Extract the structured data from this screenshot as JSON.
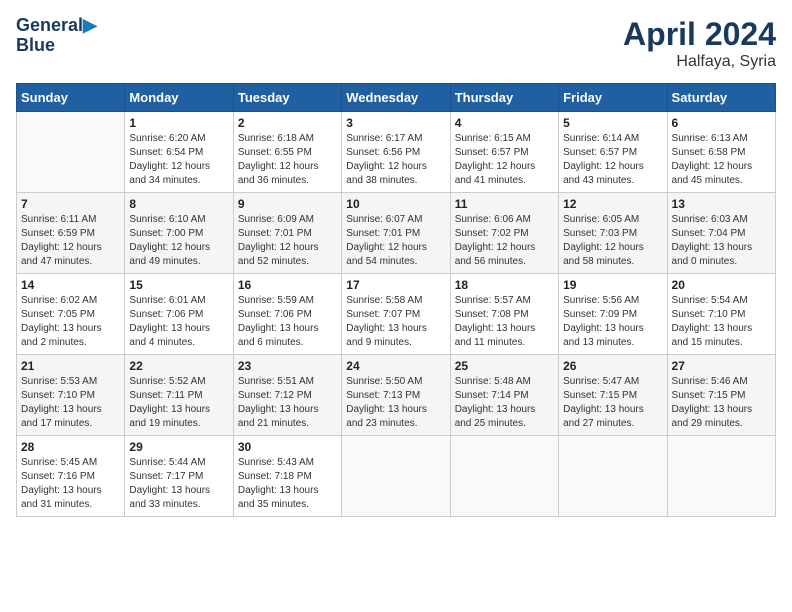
{
  "header": {
    "logo_line1": "General",
    "logo_line2": "Blue",
    "title": "April 2024",
    "subtitle": "Halfaya, Syria"
  },
  "days_of_week": [
    "Sunday",
    "Monday",
    "Tuesday",
    "Wednesday",
    "Thursday",
    "Friday",
    "Saturday"
  ],
  "weeks": [
    [
      {
        "num": "",
        "detail": ""
      },
      {
        "num": "1",
        "detail": "Sunrise: 6:20 AM\nSunset: 6:54 PM\nDaylight: 12 hours\nand 34 minutes."
      },
      {
        "num": "2",
        "detail": "Sunrise: 6:18 AM\nSunset: 6:55 PM\nDaylight: 12 hours\nand 36 minutes."
      },
      {
        "num": "3",
        "detail": "Sunrise: 6:17 AM\nSunset: 6:56 PM\nDaylight: 12 hours\nand 38 minutes."
      },
      {
        "num": "4",
        "detail": "Sunrise: 6:15 AM\nSunset: 6:57 PM\nDaylight: 12 hours\nand 41 minutes."
      },
      {
        "num": "5",
        "detail": "Sunrise: 6:14 AM\nSunset: 6:57 PM\nDaylight: 12 hours\nand 43 minutes."
      },
      {
        "num": "6",
        "detail": "Sunrise: 6:13 AM\nSunset: 6:58 PM\nDaylight: 12 hours\nand 45 minutes."
      }
    ],
    [
      {
        "num": "7",
        "detail": "Sunrise: 6:11 AM\nSunset: 6:59 PM\nDaylight: 12 hours\nand 47 minutes."
      },
      {
        "num": "8",
        "detail": "Sunrise: 6:10 AM\nSunset: 7:00 PM\nDaylight: 12 hours\nand 49 minutes."
      },
      {
        "num": "9",
        "detail": "Sunrise: 6:09 AM\nSunset: 7:01 PM\nDaylight: 12 hours\nand 52 minutes."
      },
      {
        "num": "10",
        "detail": "Sunrise: 6:07 AM\nSunset: 7:01 PM\nDaylight: 12 hours\nand 54 minutes."
      },
      {
        "num": "11",
        "detail": "Sunrise: 6:06 AM\nSunset: 7:02 PM\nDaylight: 12 hours\nand 56 minutes."
      },
      {
        "num": "12",
        "detail": "Sunrise: 6:05 AM\nSunset: 7:03 PM\nDaylight: 12 hours\nand 58 minutes."
      },
      {
        "num": "13",
        "detail": "Sunrise: 6:03 AM\nSunset: 7:04 PM\nDaylight: 13 hours\nand 0 minutes."
      }
    ],
    [
      {
        "num": "14",
        "detail": "Sunrise: 6:02 AM\nSunset: 7:05 PM\nDaylight: 13 hours\nand 2 minutes."
      },
      {
        "num": "15",
        "detail": "Sunrise: 6:01 AM\nSunset: 7:06 PM\nDaylight: 13 hours\nand 4 minutes."
      },
      {
        "num": "16",
        "detail": "Sunrise: 5:59 AM\nSunset: 7:06 PM\nDaylight: 13 hours\nand 6 minutes."
      },
      {
        "num": "17",
        "detail": "Sunrise: 5:58 AM\nSunset: 7:07 PM\nDaylight: 13 hours\nand 9 minutes."
      },
      {
        "num": "18",
        "detail": "Sunrise: 5:57 AM\nSunset: 7:08 PM\nDaylight: 13 hours\nand 11 minutes."
      },
      {
        "num": "19",
        "detail": "Sunrise: 5:56 AM\nSunset: 7:09 PM\nDaylight: 13 hours\nand 13 minutes."
      },
      {
        "num": "20",
        "detail": "Sunrise: 5:54 AM\nSunset: 7:10 PM\nDaylight: 13 hours\nand 15 minutes."
      }
    ],
    [
      {
        "num": "21",
        "detail": "Sunrise: 5:53 AM\nSunset: 7:10 PM\nDaylight: 13 hours\nand 17 minutes."
      },
      {
        "num": "22",
        "detail": "Sunrise: 5:52 AM\nSunset: 7:11 PM\nDaylight: 13 hours\nand 19 minutes."
      },
      {
        "num": "23",
        "detail": "Sunrise: 5:51 AM\nSunset: 7:12 PM\nDaylight: 13 hours\nand 21 minutes."
      },
      {
        "num": "24",
        "detail": "Sunrise: 5:50 AM\nSunset: 7:13 PM\nDaylight: 13 hours\nand 23 minutes."
      },
      {
        "num": "25",
        "detail": "Sunrise: 5:48 AM\nSunset: 7:14 PM\nDaylight: 13 hours\nand 25 minutes."
      },
      {
        "num": "26",
        "detail": "Sunrise: 5:47 AM\nSunset: 7:15 PM\nDaylight: 13 hours\nand 27 minutes."
      },
      {
        "num": "27",
        "detail": "Sunrise: 5:46 AM\nSunset: 7:15 PM\nDaylight: 13 hours\nand 29 minutes."
      }
    ],
    [
      {
        "num": "28",
        "detail": "Sunrise: 5:45 AM\nSunset: 7:16 PM\nDaylight: 13 hours\nand 31 minutes."
      },
      {
        "num": "29",
        "detail": "Sunrise: 5:44 AM\nSunset: 7:17 PM\nDaylight: 13 hours\nand 33 minutes."
      },
      {
        "num": "30",
        "detail": "Sunrise: 5:43 AM\nSunset: 7:18 PM\nDaylight: 13 hours\nand 35 minutes."
      },
      {
        "num": "",
        "detail": ""
      },
      {
        "num": "",
        "detail": ""
      },
      {
        "num": "",
        "detail": ""
      },
      {
        "num": "",
        "detail": ""
      }
    ]
  ]
}
